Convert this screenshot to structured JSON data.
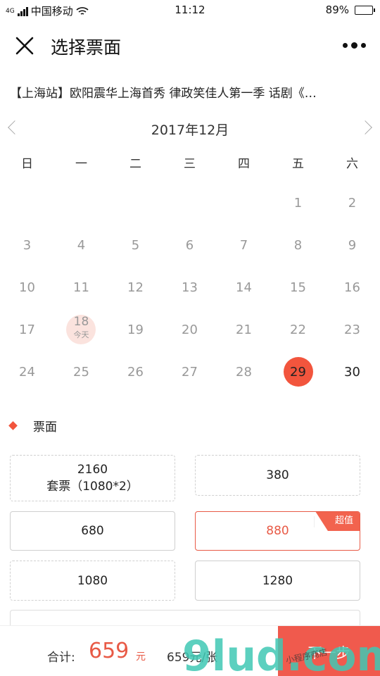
{
  "status_bar": {
    "network": "4G",
    "carrier": "中国移动",
    "time": "11:12",
    "battery": "89%",
    "battery_level": 0.89
  },
  "header": {
    "title": "选择票面"
  },
  "event": {
    "title": "【上海站】欧阳震华上海首秀 律政笑佳人第一季 话剧《…"
  },
  "calendar": {
    "month_label": "2017年12月",
    "weekdays": [
      "日",
      "一",
      "二",
      "三",
      "四",
      "五",
      "六"
    ],
    "today_label": "今天",
    "days": [
      [
        "",
        "",
        "",
        "",
        "",
        "1",
        "2"
      ],
      [
        "3",
        "4",
        "5",
        "6",
        "7",
        "8",
        "9"
      ],
      [
        "10",
        "11",
        "12",
        "13",
        "14",
        "15",
        "16"
      ],
      [
        "17",
        "18",
        "19",
        "20",
        "21",
        "22",
        "23"
      ],
      [
        "24",
        "25",
        "26",
        "27",
        "28",
        "29",
        "30"
      ]
    ],
    "today": "18",
    "selected": "29",
    "available": [
      "29",
      "30"
    ]
  },
  "tickets": {
    "section_title": "票面",
    "options": [
      {
        "price": "2160",
        "note": "套票（1080*2）"
      },
      {
        "price": "380"
      },
      {
        "price": "680"
      },
      {
        "price": "880",
        "badge": "超值"
      },
      {
        "price": "1080"
      },
      {
        "price": "1280"
      }
    ]
  },
  "footer": {
    "total_label": "合计:",
    "total_price": "659",
    "total_unit": "元",
    "unit_price": "659元/张",
    "next_label": "下一步"
  },
  "watermark": {
    "text": "9lud.com",
    "slogan": "小程序商店"
  },
  "colors": {
    "accent": "#f2553d",
    "today_bg": "#fbe3de",
    "next_button": "#f05a4d",
    "watermark_teal": "#3fc8b4"
  }
}
